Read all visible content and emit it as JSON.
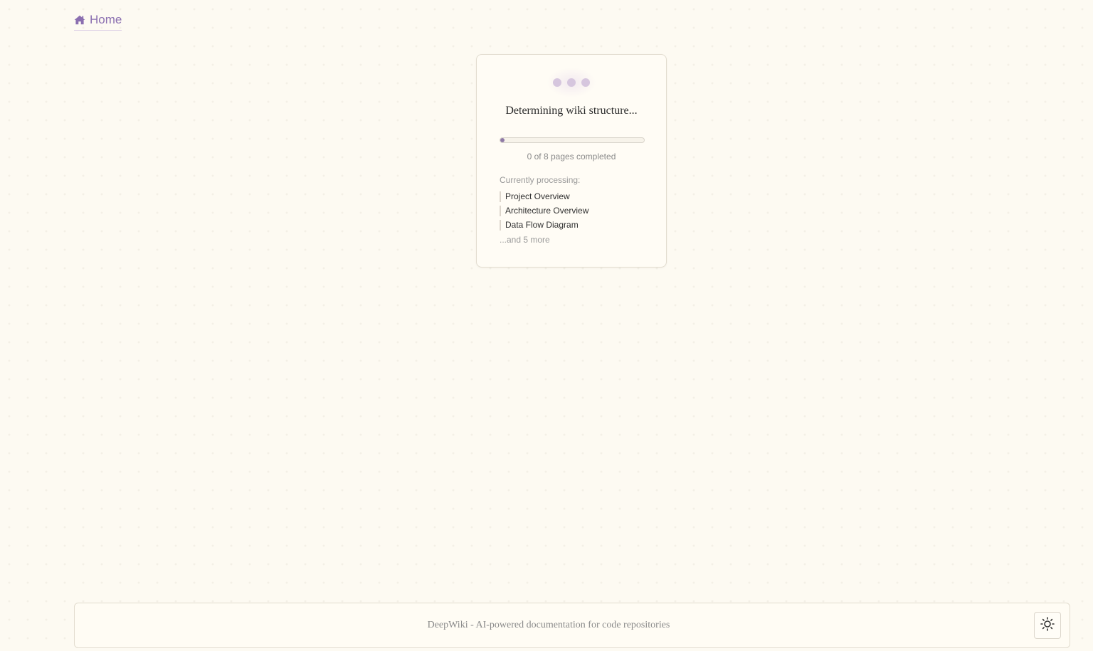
{
  "header": {
    "home_label": "Home",
    "home_icon": "home-icon"
  },
  "loading": {
    "title": "Determining wiki structure...",
    "pages_completed": 0,
    "pages_total": 8,
    "progress_fraction": 0.03,
    "progress_text": "0 of 8 pages completed",
    "processing_label": "Currently processing:",
    "processing_items": [
      "Project Overview",
      "Architecture Overview",
      "Data Flow Diagram"
    ],
    "more_text": "...and 5 more"
  },
  "footer": {
    "text": "DeepWiki - AI-powered documentation for code repositories",
    "theme_toggle_icon": "sun-icon"
  },
  "colors": {
    "accent": "#8b6fb0",
    "background": "#fdfaf2",
    "progress_fill": "#8f7aa6"
  }
}
